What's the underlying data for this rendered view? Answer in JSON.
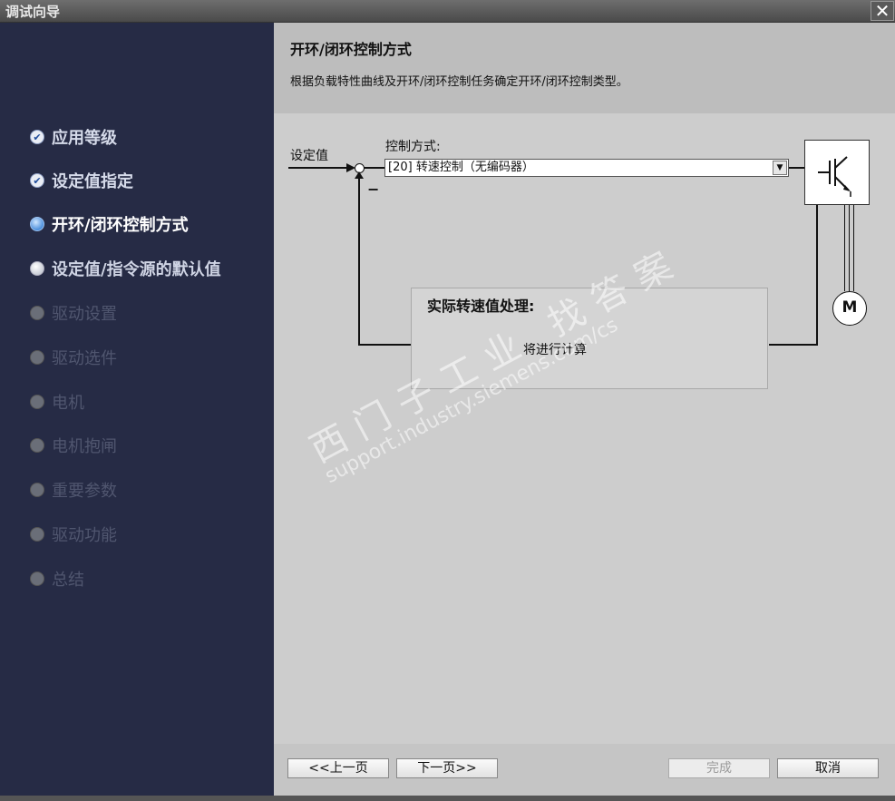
{
  "window": {
    "title": "调试向导",
    "close_symbol": "✕"
  },
  "steps": [
    {
      "label": "应用等级",
      "state": "done"
    },
    {
      "label": "设定值指定",
      "state": "done"
    },
    {
      "label": "开环/闭环控制方式",
      "state": "current"
    },
    {
      "label": "设定值/指令源的默认值",
      "state": "next"
    },
    {
      "label": "驱动设置",
      "state": "disabled"
    },
    {
      "label": "驱动选件",
      "state": "disabled"
    },
    {
      "label": "电机",
      "state": "disabled"
    },
    {
      "label": "电机抱闸",
      "state": "disabled"
    },
    {
      "label": "重要参数",
      "state": "disabled"
    },
    {
      "label": "驱动功能",
      "state": "disabled"
    },
    {
      "label": "总结",
      "state": "disabled"
    }
  ],
  "header": {
    "title": "开环/闭环控制方式",
    "description": "根据负载特性曲线及开环/闭环控制任务确定开环/闭环控制类型。"
  },
  "diagram": {
    "setpoint_label": "设定值",
    "control_mode_label": "控制方式:",
    "control_mode_value": "[20] 转速控制（无编码器）",
    "minus_sign": "−",
    "motor_label": "M",
    "speed_box_title": "实际转速值处理:",
    "speed_box_text": "将进行计算"
  },
  "watermark": {
    "line1": "西门子工业 找答案",
    "line2": "support.industry.siemens.com/cs"
  },
  "footer": {
    "prev_label": "<<上一页",
    "next_label": "下一页>>",
    "finish_label": "完成",
    "cancel_label": "取消"
  }
}
